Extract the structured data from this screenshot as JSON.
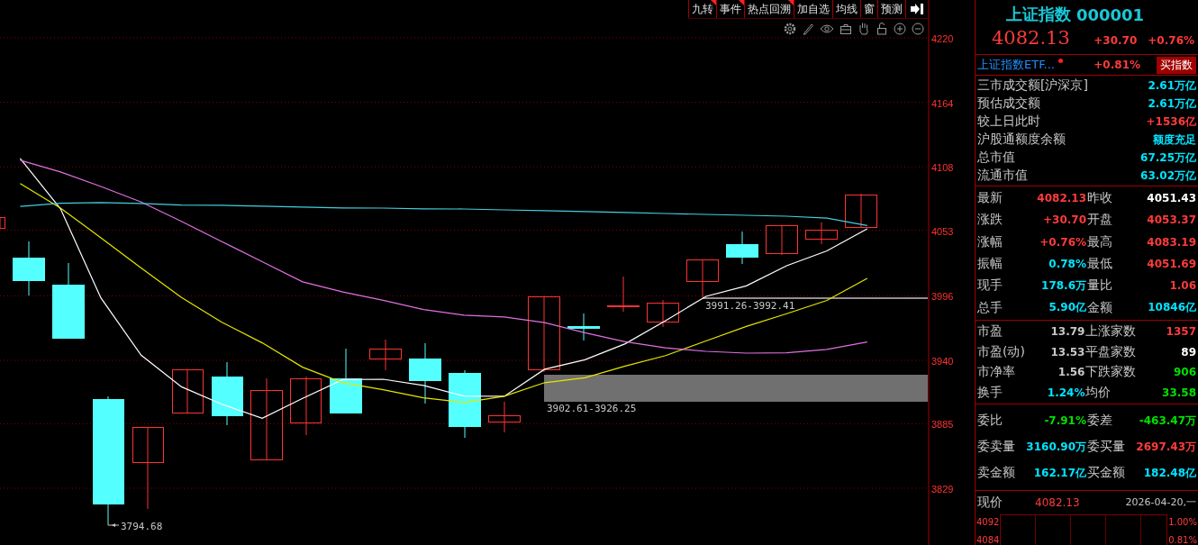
{
  "toolbar": {
    "buttons": [
      {
        "label": "九转",
        "flagged": true
      },
      {
        "label": "事件",
        "flagged": true
      },
      {
        "label": "热点回溯",
        "flagged": true
      },
      {
        "label": "加自选",
        "flagged": false
      },
      {
        "label": "均线",
        "flagged": false
      },
      {
        "label": "窗",
        "flagged": false
      },
      {
        "label": "预测",
        "flagged": false
      }
    ]
  },
  "chart": {
    "chart_data": {
      "type": "line",
      "grid": true,
      "ylim": [
        3779.7,
        4252.8
      ],
      "yticks": [
        4220,
        4164,
        4108,
        4053,
        3996,
        3940,
        3885,
        3829
      ],
      "annotations": [
        {
          "text": "3794.68"
        }
      ],
      "series": [
        {
          "color": "#ffffff",
          "values": [
            4115.3,
            4071.5,
            3994.2,
            3944.5,
            3917.0,
            3901.9,
            3889.7,
            3906.9,
            3923.3,
            3923.6,
            3918.3,
            3909.0,
            3908.8,
            3932.3,
            3940.5,
            3954.4,
            3974.5,
            3995.5,
            4004.6,
            4022.1,
            4035.0,
            4054.2,
            null
          ]
        },
        {
          "color": "#e6e600",
          "values": [
            4093.5,
            4072.2,
            4046.4,
            4020.1,
            3994.5,
            3973.1,
            3955.2,
            3934.1,
            3920.6,
            3914.5,
            3907.5,
            3903.4,
            3908.8,
            3920.6,
            3924.8,
            3935.1,
            3944.1,
            3956.8,
            3969.4,
            3980.4,
            3992.0,
            4011.2,
            null
          ]
        },
        {
          "color": "#e070e0",
          "values": [
            4113.8,
            4103.5,
            4090.9,
            4077.5,
            4060.6,
            4043.1,
            4025.6,
            4008.1,
            3999.3,
            3992.1,
            3984.1,
            3979.2,
            3977.6,
            3972.7,
            3964.0,
            3956.2,
            3950.8,
            3947.8,
            3946.3,
            3946.6,
            3949.5,
            3955.9,
            null
          ]
        },
        {
          "color": "#40d0e0",
          "values": [
            4073.6,
            4076.3,
            4076.9,
            4076.2,
            4074.8,
            4074.6,
            4073.9,
            4073.1,
            4072.3,
            4072.2,
            4071.5,
            4071.4,
            4070.6,
            4069.9,
            4069.1,
            4068.3,
            4067.5,
            4066.7,
            4065.9,
            4065.1,
            4063.5,
            4057.1,
            null
          ]
        }
      ]
    },
    "zones": [
      {
        "label": "3991.26-3992.41"
      },
      {
        "label": "3902.61-3926.25"
      }
    ]
  },
  "quote": {
    "name": "上证指数",
    "code": "000001",
    "price": "4082.13",
    "change": "+30.70",
    "change_pct": "+0.76%"
  },
  "etf": {
    "name": "上证指数ETF...",
    "change_pct": "+0.81%",
    "button": "买指数"
  },
  "market_rows": [
    {
      "label": "三市成交额[沪深京]",
      "value": "2.61万亿",
      "color": "#00e5ff"
    },
    {
      "label": "预估成交额",
      "value": "2.61万亿",
      "color": "#00e5ff"
    },
    {
      "label": "较上日此时",
      "value": "+1536亿",
      "color": "#ff3b3b"
    },
    {
      "label": "沪股通额度余额",
      "value": "额度充足",
      "color": "#00e5ff"
    },
    {
      "label": "总市值",
      "value": "67.25万亿",
      "color": "#00e5ff"
    },
    {
      "label": "流通市值",
      "value": "63.02万亿",
      "color": "#00e5ff"
    }
  ],
  "stats": [
    [
      {
        "label": "最新",
        "value": "4082.13",
        "color": "#ff3b3b"
      },
      {
        "label": "昨收",
        "value": "4051.43",
        "color": "#ffffff"
      },
      {
        "label": "涨跌",
        "value": "+30.70",
        "color": "#ff3b3b"
      },
      {
        "label": "开盘",
        "value": "4053.37",
        "color": "#ff3b3b"
      },
      {
        "label": "涨幅",
        "value": "+0.76%",
        "color": "#ff3b3b"
      },
      {
        "label": "最高",
        "value": "4083.19",
        "color": "#ff3b3b"
      },
      {
        "label": "振幅",
        "value": "0.78%",
        "color": "#00e5ff"
      },
      {
        "label": "最低",
        "value": "4051.69",
        "color": "#ff3b3b"
      },
      {
        "label": "现手",
        "value": "178.6万",
        "color": "#00e5ff"
      },
      {
        "label": "量比",
        "value": "1.06",
        "color": "#ff3b3b"
      },
      {
        "label": "总手",
        "value": "5.90亿",
        "color": "#00e5ff"
      },
      {
        "label": "金额",
        "value": "10846亿",
        "color": "#00e5ff"
      }
    ],
    [
      {
        "label": "市盈",
        "value": "13.79",
        "color": "#c8c8c8"
      },
      {
        "label": "上涨家数",
        "value": "1357",
        "color": "#ff3b3b"
      },
      {
        "label": "市盈(动)",
        "value": "13.53",
        "color": "#c8c8c8"
      },
      {
        "label": "平盘家数",
        "value": "89",
        "color": "#ffffff"
      },
      {
        "label": "市净率",
        "value": "1.56",
        "color": "#c8c8c8"
      },
      {
        "label": "下跌家数",
        "value": "906",
        "color": "#00e000"
      },
      {
        "label": "换手",
        "value": "1.24%",
        "color": "#00e5ff"
      },
      {
        "label": "均价",
        "value": "33.58",
        "color": "#00e000"
      }
    ],
    [
      {
        "label": "委比",
        "value": "-7.91%",
        "color": "#00e000"
      },
      {
        "label": "委差",
        "value": "-463.47万",
        "color": "#00e000"
      },
      {
        "label": "委卖量",
        "value": "3160.90万",
        "color": "#00e5ff"
      },
      {
        "label": "委买量",
        "value": "2697.43万",
        "color": "#ff3b3b"
      },
      {
        "label": "卖金额",
        "value": "162.17亿",
        "color": "#00e5ff"
      },
      {
        "label": "买金额",
        "value": "182.48亿",
        "color": "#00e5ff"
      }
    ]
  ],
  "now": {
    "label": "现价",
    "value": "4082.13",
    "date": "2026-04-20,一"
  },
  "mini_chart": {
    "left_labels": [
      "4092",
      "4084"
    ],
    "right_labels": [
      "1.00%",
      "0.81%"
    ]
  }
}
